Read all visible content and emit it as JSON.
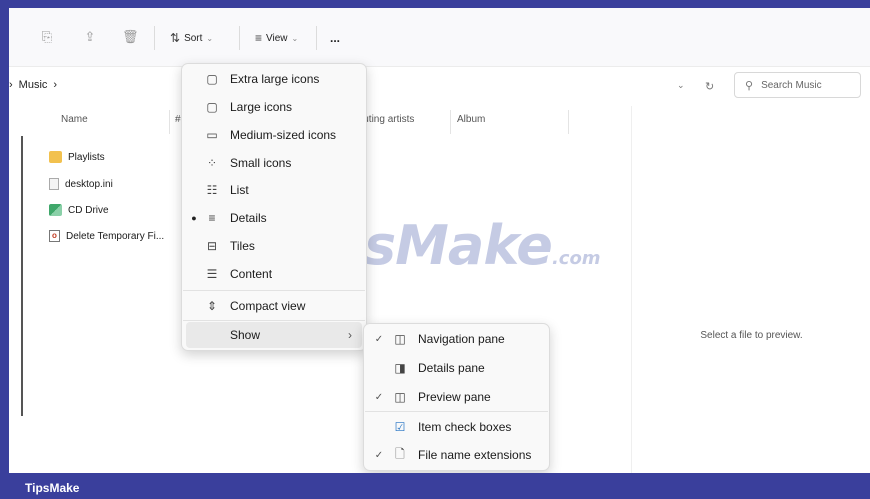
{
  "toolbar": {
    "sort_label": "Sort",
    "view_label": "View",
    "more_label": "..."
  },
  "address": {
    "crumb_location": "Music",
    "crumb_separator": "›",
    "search_placeholder": "Search Music"
  },
  "columns": [
    "Name",
    "#",
    "Contributing artists",
    "Album"
  ],
  "files": [
    {
      "name": "Playlists",
      "icon": "folder-icon"
    },
    {
      "name": "desktop.ini",
      "icon": "ini-file-icon"
    },
    {
      "name": "CD Drive",
      "icon": "cd-drive-icon"
    },
    {
      "name": "Delete Temporary Fi...",
      "icon": "office-file-icon"
    }
  ],
  "preview_text": "Select a file to preview.",
  "watermark": {
    "main": "TipsMake",
    "suffix": ".com"
  },
  "view_menu": {
    "items": [
      {
        "label": "Extra large icons",
        "icon": "monitor-icon"
      },
      {
        "label": "Large icons",
        "icon": "monitor-icon"
      },
      {
        "label": "Medium-sized icons",
        "icon": "monitor-icon"
      },
      {
        "label": "Small icons",
        "icon": "small-icons-icon"
      },
      {
        "label": "List",
        "icon": "list-icon"
      },
      {
        "label": "Details",
        "icon": "details-icon",
        "selected": true
      },
      {
        "label": "Tiles",
        "icon": "tiles-icon"
      },
      {
        "label": "Content",
        "icon": "content-icon"
      },
      {
        "label": "Compact view",
        "icon": "compact-view-icon"
      },
      {
        "label": "Show",
        "icon": "",
        "submenu": true
      }
    ]
  },
  "show_menu": {
    "items": [
      {
        "label": "Navigation pane",
        "checked": true,
        "icon": "navigation-pane-icon"
      },
      {
        "label": "Details pane",
        "checked": false,
        "icon": "details-pane-icon"
      },
      {
        "label": "Preview pane",
        "checked": true,
        "icon": "preview-pane-icon"
      },
      {
        "label": "Item check boxes",
        "checked": false,
        "icon": "item-check-boxes-icon"
      },
      {
        "label": "File name extensions",
        "checked": true,
        "icon": "file-extension-icon"
      }
    ]
  },
  "footer": {
    "text": "TipsMake"
  },
  "colors": {
    "frame": "#3a3f9c",
    "folder": "#f2c14e",
    "highlight": "#e9e9e9"
  }
}
